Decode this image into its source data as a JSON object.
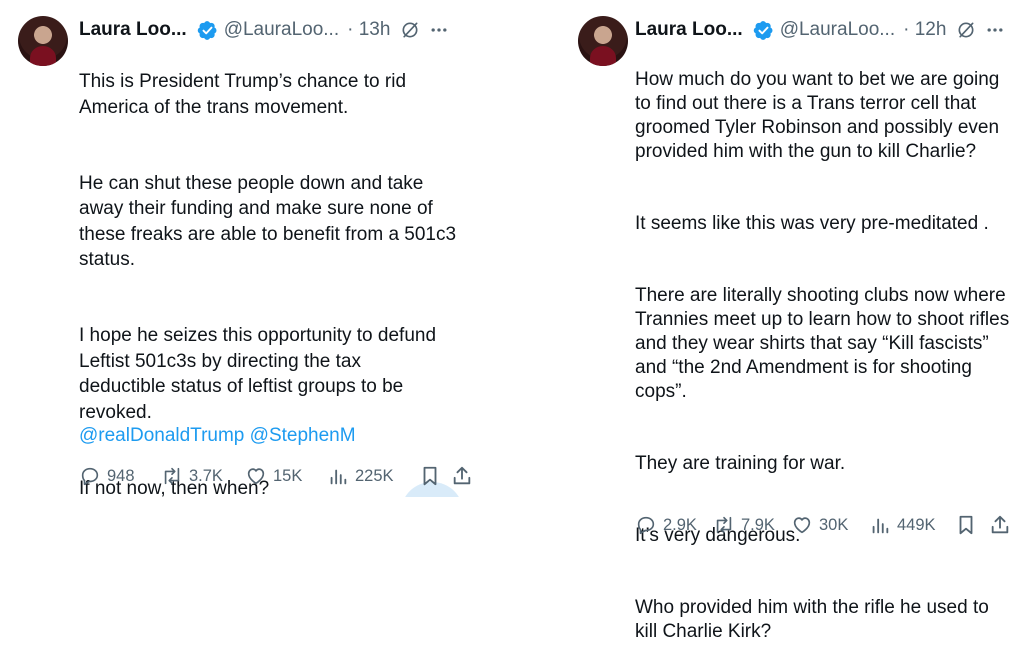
{
  "colors": {
    "text": "#0f1419",
    "muted": "#536471",
    "link": "#1d9bf0",
    "verified": "#1d9bf0"
  },
  "tweets": [
    {
      "author": {
        "name": "Laura Loo...",
        "handle": "@LauraLoo...",
        "time": "· 13h"
      },
      "paragraphs": [
        "This is President Trump’s chance to rid\nAmerica of the trans movement.",
        "He can shut these people down and take\naway their funding and make sure none of\nthese freaks are able to benefit from a 501c3\nstatus.",
        "I hope he seizes this opportunity to defund\nLeftist 501c3s by directing the tax\ndeductible status of leftist groups to be\nrevoked.",
        "If not now, then when?"
      ],
      "mentions": [
        "@realDonaldTrump",
        "@StephenM"
      ],
      "stats": {
        "replies": "948",
        "reposts": "3.7K",
        "likes": "15K",
        "views": "225K"
      },
      "icons": [
        "verified-badge-icon",
        "grok-icon",
        "more-icon",
        "reply-icon",
        "repost-icon",
        "like-icon",
        "views-icon",
        "bookmark-icon",
        "share-icon"
      ]
    },
    {
      "author": {
        "name": "Laura Loo...",
        "handle": "@LauraLoo...",
        "time": "· 12h"
      },
      "paragraphs": [
        "How much do you want to bet we are going\nto find out there is a Trans terror cell that\ngroomed Tyler Robinson and possibly even\nprovided him with the gun to kill Charlie?",
        "It seems like this was very pre-meditated .",
        "There are literally shooting clubs now where\nTrannies meet up to learn how to shoot rifles\nand they wear shirts that say “Kill fascists”\nand “the 2nd Amendment is for shooting\ncops”.",
        "They are training for war.",
        "It’s very dangerous.",
        "Who provided him with the rifle he used to\nkill Charlie Kirk?"
      ],
      "stats": {
        "replies": "2.9K",
        "reposts": "7.9K",
        "likes": "30K",
        "views": "449K"
      },
      "icons": [
        "verified-badge-icon",
        "grok-icon",
        "more-icon",
        "reply-icon",
        "repost-icon",
        "like-icon",
        "views-icon",
        "bookmark-icon",
        "share-icon"
      ]
    }
  ]
}
